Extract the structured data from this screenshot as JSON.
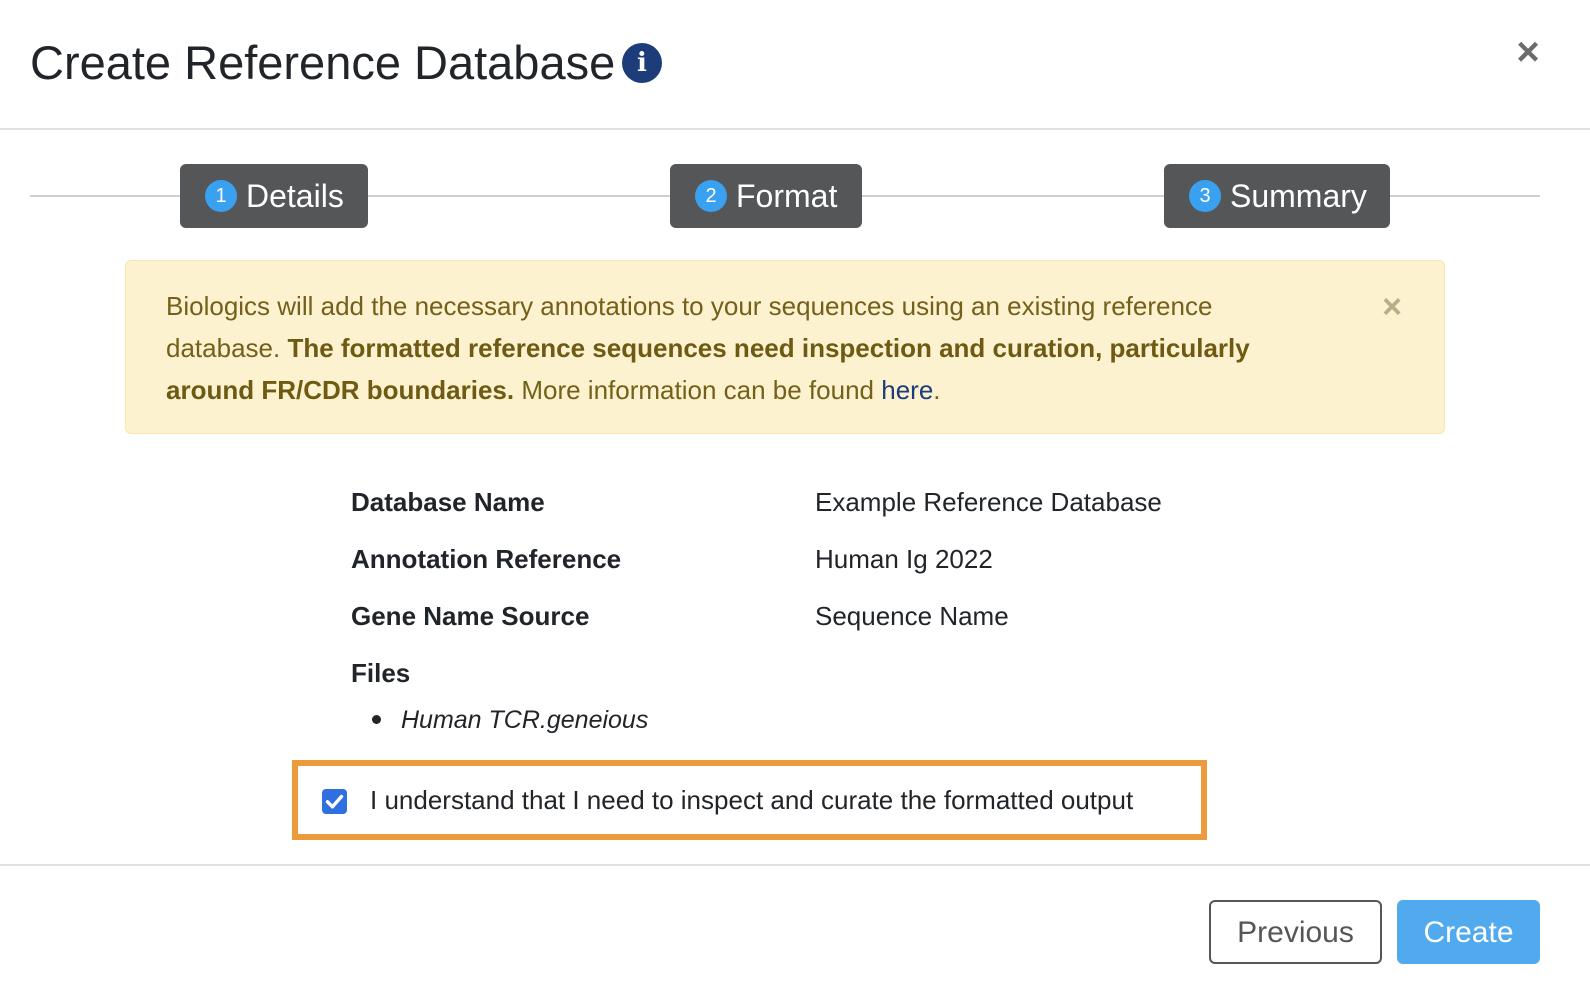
{
  "modal": {
    "title": "Create Reference Database",
    "info_icon_glyph": "i",
    "close_glyph": "×"
  },
  "stepper": {
    "steps": [
      {
        "number": "1",
        "label": "Details"
      },
      {
        "number": "2",
        "label": "Format"
      },
      {
        "number": "3",
        "label": "Summary"
      }
    ]
  },
  "alert": {
    "text_start": "Biologics will add the necessary annotations to your sequences using an existing reference database. ",
    "text_bold": "The formatted reference sequences need inspection and curation, particularly around FR/CDR boundaries.",
    "text_more": " More information can be found ",
    "link_text": "here",
    "text_end": ".",
    "close_glyph": "×",
    "background_color": "#fcf2cf",
    "text_color": "#74601a"
  },
  "summary": {
    "database_name_label": "Database Name",
    "database_name_value": "Example Reference Database",
    "annotation_reference_label": "Annotation Reference",
    "annotation_reference_value": "Human Ig 2022",
    "gene_name_source_label": "Gene Name Source",
    "gene_name_source_value": "Sequence Name",
    "files_label": "Files",
    "files": [
      "Human TCR.geneious"
    ]
  },
  "confirm": {
    "checked": true,
    "label": "I understand that I need to inspect and curate the formatted output",
    "highlight_color": "#ec9a3c"
  },
  "footer": {
    "previous_label": "Previous",
    "create_label": "Create",
    "create_color": "#51a9ee"
  }
}
